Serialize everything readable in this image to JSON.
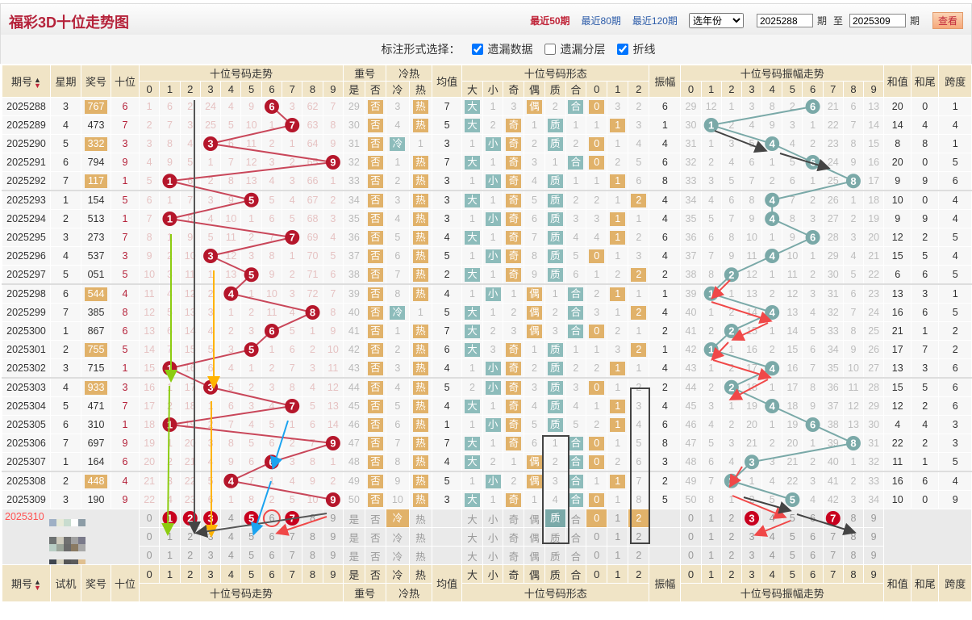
{
  "title": "福彩3D十位走势图",
  "nav": {
    "recent50": "最近50期",
    "recent80": "最近80期",
    "recent120": "最近120期",
    "year_select": "选年份",
    "from": "2025288",
    "period1": "期",
    "to_label": "至",
    "to": "2025309",
    "period2": "期",
    "view": "查看"
  },
  "options": {
    "label": "标注形式选择：",
    "opt1": "遗漏数据",
    "opt1_checked": true,
    "opt2": "遗漏分层",
    "opt2_checked": false,
    "opt3": "折线",
    "opt3_checked": true
  },
  "headers": {
    "issue": "期号",
    "week": "星期",
    "trial": "试机",
    "prize": "奖号",
    "tens": "十位",
    "trend": "十位号码走势",
    "repeat": "重号",
    "yes": "是",
    "no": "否",
    "hc": "冷热",
    "cold": "冷",
    "hot": "热",
    "avg": "均值",
    "shape": "十位号码形态",
    "shapes": [
      "大",
      "小",
      "奇",
      "偶",
      "质",
      "合"
    ],
    "mod3": [
      "0",
      "1",
      "2"
    ],
    "amp": "振幅",
    "amp_trend": "十位号码振幅走势",
    "sum": "和值",
    "tail": "和尾",
    "span": "跨度",
    "digits": [
      "0",
      "1",
      "2",
      "3",
      "4",
      "5",
      "6",
      "7",
      "8",
      "9"
    ]
  },
  "rows": [
    {
      "issue": "2025288",
      "week": "3",
      "prize": "767",
      "tens": "6",
      "trend": [
        1,
        6,
        2,
        24,
        4,
        9,
        6,
        3,
        62,
        7
      ],
      "mid": [
        "29",
        "否",
        "3",
        "热",
        "7",
        "大",
        "1",
        "3",
        "偶",
        "2",
        "合",
        "0",
        "3",
        "2",
        "6"
      ],
      "amp": [
        29,
        12,
        1,
        3,
        8,
        2,
        6,
        21,
        6,
        13
      ],
      "sum": "20",
      "tail": "0",
      "span": "1"
    },
    {
      "issue": "2025289",
      "week": "4",
      "prize": "473",
      "tens": "7",
      "trend": [
        2,
        7,
        3,
        25,
        5,
        10,
        1,
        7,
        63,
        8
      ],
      "mid": [
        "30",
        "否",
        "4",
        "热",
        "5",
        "大",
        "2",
        "奇",
        "1",
        "质",
        "1",
        "1",
        "1",
        "3",
        "1"
      ],
      "amp": [
        30,
        1,
        2,
        4,
        9,
        3,
        1,
        22,
        7,
        14
      ],
      "sum": "14",
      "tail": "4",
      "span": "4"
    },
    {
      "issue": "2025290",
      "week": "5",
      "prize": "332",
      "tens": "3",
      "trend": [
        3,
        8,
        4,
        3,
        6,
        11,
        2,
        1,
        64,
        9
      ],
      "mid": [
        "31",
        "否",
        "冷",
        "1",
        "3",
        "1",
        "小",
        "奇",
        "2",
        "质",
        "2",
        "0",
        "1",
        "4",
        "4"
      ],
      "amp": [
        31,
        1,
        3,
        5,
        4,
        4,
        2,
        23,
        8,
        15
      ],
      "sum": "8",
      "tail": "8",
      "span": "1"
    },
    {
      "issue": "2025291",
      "week": "6",
      "prize": "794",
      "tens": "9",
      "trend": [
        4,
        9,
        5,
        1,
        7,
        12,
        3,
        2,
        65,
        9
      ],
      "mid": [
        "32",
        "否",
        "1",
        "热",
        "7",
        "大",
        "1",
        "奇",
        "3",
        "1",
        "合",
        "0",
        "2",
        "5",
        "6"
      ],
      "amp": [
        32,
        2,
        4,
        6,
        1,
        5,
        6,
        24,
        9,
        16
      ],
      "sum": "20",
      "tail": "0",
      "span": "5"
    },
    {
      "issue": "2025292",
      "week": "7",
      "prize": "117",
      "tens": "1",
      "trend": [
        5,
        1,
        6,
        2,
        8,
        13,
        4,
        3,
        66,
        1
      ],
      "mid": [
        "33",
        "否",
        "2",
        "热",
        "3",
        "1",
        "小",
        "奇",
        "4",
        "质",
        "1",
        "1",
        "1",
        "6",
        "8"
      ],
      "amp": [
        33,
        3,
        5,
        7,
        2,
        6,
        1,
        25,
        8,
        17
      ],
      "sum": "9",
      "tail": "9",
      "span": "6"
    },
    {
      "issue": "2025293",
      "week": "1",
      "prize": "154",
      "tens": "5",
      "trend": [
        6,
        1,
        7,
        3,
        9,
        5,
        5,
        4,
        67,
        2
      ],
      "mid": [
        "34",
        "否",
        "3",
        "热",
        "3",
        "大",
        "1",
        "奇",
        "5",
        "质",
        "2",
        "2",
        "1",
        "2",
        "4"
      ],
      "amp": [
        34,
        4,
        6,
        8,
        4,
        7,
        2,
        26,
        1,
        18
      ],
      "sum": "10",
      "tail": "0",
      "span": "4"
    },
    {
      "issue": "2025294",
      "week": "2",
      "prize": "513",
      "tens": "1",
      "trend": [
        7,
        1,
        8,
        4,
        10,
        1,
        6,
        5,
        68,
        3
      ],
      "mid": [
        "35",
        "否",
        "4",
        "热",
        "3",
        "1",
        "小",
        "奇",
        "6",
        "质",
        "3",
        "3",
        "1",
        "1",
        "4"
      ],
      "amp": [
        35,
        5,
        7,
        9,
        4,
        8,
        3,
        27,
        2,
        19
      ],
      "sum": "9",
      "tail": "9",
      "span": "4"
    },
    {
      "issue": "2025295",
      "week": "3",
      "prize": "273",
      "tens": "7",
      "trend": [
        8,
        1,
        9,
        5,
        11,
        2,
        7,
        7,
        69,
        4
      ],
      "mid": [
        "36",
        "否",
        "5",
        "热",
        "4",
        "大",
        "1",
        "奇",
        "7",
        "质",
        "4",
        "4",
        "1",
        "2",
        "6"
      ],
      "amp": [
        36,
        6,
        8,
        10,
        1,
        9,
        6,
        28,
        3,
        20
      ],
      "sum": "12",
      "tail": "2",
      "span": "5"
    },
    {
      "issue": "2025296",
      "week": "4",
      "prize": "537",
      "tens": "3",
      "trend": [
        9,
        2,
        10,
        3,
        12,
        3,
        8,
        1,
        70,
        5
      ],
      "mid": [
        "37",
        "否",
        "6",
        "热",
        "5",
        "1",
        "小",
        "奇",
        "8",
        "质",
        "5",
        "0",
        "1",
        "3",
        "4"
      ],
      "amp": [
        37,
        7,
        9,
        11,
        4,
        10,
        1,
        29,
        4,
        21
      ],
      "sum": "15",
      "tail": "5",
      "span": "4"
    },
    {
      "issue": "2025297",
      "week": "5",
      "prize": "051",
      "tens": "5",
      "trend": [
        10,
        3,
        11,
        1,
        13,
        5,
        9,
        2,
        71,
        6
      ],
      "mid": [
        "38",
        "否",
        "7",
        "热",
        "2",
        "大",
        "1",
        "奇",
        "9",
        "质",
        "6",
        "1",
        "2",
        "2",
        "2"
      ],
      "amp": [
        38,
        8,
        2,
        12,
        1,
        11,
        2,
        30,
        5,
        22
      ],
      "sum": "6",
      "tail": "6",
      "span": "5"
    },
    {
      "issue": "2025298",
      "week": "6",
      "prize": "544",
      "tens": "4",
      "trend": [
        11,
        4,
        12,
        2,
        4,
        1,
        10,
        3,
        72,
        7
      ],
      "mid": [
        "39",
        "否",
        "8",
        "热",
        "4",
        "1",
        "小",
        "1",
        "偶",
        "1",
        "合",
        "2",
        "1",
        "1",
        "1"
      ],
      "amp": [
        39,
        1,
        1,
        13,
        2,
        12,
        3,
        31,
        6,
        23
      ],
      "sum": "13",
      "tail": "3",
      "span": "1"
    },
    {
      "issue": "2025299",
      "week": "7",
      "prize": "385",
      "tens": "8",
      "trend": [
        12,
        5,
        13,
        3,
        1,
        2,
        11,
        4,
        8,
        8
      ],
      "mid": [
        "40",
        "否",
        "冷",
        "1",
        "5",
        "大",
        "1",
        "2",
        "偶",
        "2",
        "合",
        "3",
        "1",
        "2",
        "4"
      ],
      "amp": [
        40,
        1,
        2,
        14,
        4,
        13,
        4,
        32,
        7,
        24
      ],
      "sum": "16",
      "tail": "6",
      "span": "5"
    },
    {
      "issue": "2025300",
      "week": "1",
      "prize": "867",
      "tens": "6",
      "trend": [
        13,
        6,
        14,
        4,
        2,
        3,
        6,
        5,
        1,
        9
      ],
      "mid": [
        "41",
        "否",
        "1",
        "热",
        "7",
        "大",
        "2",
        "3",
        "偶",
        "3",
        "合",
        "0",
        "2",
        "1",
        "2"
      ],
      "amp": [
        41,
        2,
        2,
        15,
        1,
        14,
        5,
        33,
        8,
        25
      ],
      "sum": "21",
      "tail": "1",
      "span": "2"
    },
    {
      "issue": "2025301",
      "week": "2",
      "prize": "755",
      "tens": "5",
      "trend": [
        14,
        7,
        15,
        5,
        3,
        5,
        1,
        6,
        2,
        10
      ],
      "mid": [
        "42",
        "否",
        "2",
        "热",
        "6",
        "大",
        "3",
        "奇",
        "1",
        "质",
        "1",
        "1",
        "3",
        "2",
        "1"
      ],
      "amp": [
        42,
        1,
        1,
        16,
        2,
        15,
        6,
        34,
        9,
        26
      ],
      "sum": "17",
      "tail": "7",
      "span": "2"
    },
    {
      "issue": "2025302",
      "week": "3",
      "prize": "715",
      "tens": "1",
      "trend": [
        15,
        1,
        16,
        6,
        4,
        1,
        2,
        7,
        3,
        11
      ],
      "mid": [
        "43",
        "否",
        "3",
        "热",
        "4",
        "1",
        "小",
        "奇",
        "2",
        "质",
        "2",
        "2",
        "1",
        "1",
        "4"
      ],
      "amp": [
        43,
        1,
        2,
        17,
        4,
        16,
        7,
        35,
        10,
        27
      ],
      "sum": "13",
      "tail": "3",
      "span": "6"
    },
    {
      "issue": "2025303",
      "week": "4",
      "prize": "933",
      "tens": "3",
      "trend": [
        16,
        1,
        17,
        3,
        5,
        2,
        3,
        8,
        4,
        12
      ],
      "mid": [
        "44",
        "否",
        "4",
        "热",
        "5",
        "2",
        "小",
        "奇",
        "3",
        "质",
        "3",
        "0",
        "1",
        "2",
        "2"
      ],
      "amp": [
        44,
        2,
        2,
        18,
        1,
        17,
        8,
        36,
        11,
        28
      ],
      "sum": "15",
      "tail": "5",
      "span": "6"
    },
    {
      "issue": "2025304",
      "week": "5",
      "prize": "471",
      "tens": "7",
      "trend": [
        17,
        2,
        18,
        1,
        6,
        3,
        4,
        7,
        5,
        13
      ],
      "mid": [
        "45",
        "否",
        "5",
        "热",
        "4",
        "大",
        "1",
        "奇",
        "4",
        "质",
        "4",
        "1",
        "1",
        "3",
        "4"
      ],
      "amp": [
        45,
        3,
        1,
        19,
        4,
        18,
        9,
        37,
        12,
        29
      ],
      "sum": "12",
      "tail": "2",
      "span": "6"
    },
    {
      "issue": "2025305",
      "week": "6",
      "prize": "310",
      "tens": "1",
      "trend": [
        18,
        1,
        19,
        2,
        7,
        4,
        5,
        1,
        6,
        14
      ],
      "mid": [
        "46",
        "否",
        "6",
        "热",
        "1",
        "1",
        "小",
        "奇",
        "5",
        "质",
        "5",
        "2",
        "1",
        "4",
        "6"
      ],
      "amp": [
        46,
        4,
        2,
        20,
        1,
        19,
        6,
        38,
        13,
        30
      ],
      "sum": "4",
      "tail": "4",
      "span": "3"
    },
    {
      "issue": "2025306",
      "week": "7",
      "prize": "697",
      "tens": "9",
      "trend": [
        19,
        1,
        20,
        3,
        8,
        5,
        6,
        2,
        7,
        9
      ],
      "mid": [
        "47",
        "否",
        "7",
        "热",
        "7",
        "大",
        "1",
        "奇",
        "6",
        "1",
        "合",
        "0",
        "1",
        "5",
        "8"
      ],
      "amp": [
        47,
        5,
        3,
        21,
        2,
        20,
        1,
        39,
        8,
        31
      ],
      "sum": "22",
      "tail": "2",
      "span": "3"
    },
    {
      "issue": "2025307",
      "week": "1",
      "prize": "164",
      "tens": "6",
      "trend": [
        20,
        2,
        21,
        4,
        9,
        6,
        6,
        3,
        8,
        1
      ],
      "mid": [
        "48",
        "否",
        "8",
        "热",
        "4",
        "大",
        "2",
        "1",
        "偶",
        "2",
        "合",
        "0",
        "2",
        "6",
        "3"
      ],
      "amp": [
        48,
        6,
        4,
        3,
        3,
        21,
        2,
        40,
        1,
        32
      ],
      "sum": "11",
      "tail": "1",
      "span": "5"
    },
    {
      "issue": "2025308",
      "week": "2",
      "prize": "448",
      "tens": "4",
      "trend": [
        21,
        3,
        22,
        5,
        4,
        7,
        1,
        4,
        9,
        2
      ],
      "mid": [
        "49",
        "否",
        "9",
        "热",
        "5",
        "1",
        "小",
        "2",
        "偶",
        "3",
        "合",
        "1",
        "1",
        "7",
        "2"
      ],
      "amp": [
        49,
        7,
        2,
        1,
        4,
        22,
        3,
        41,
        2,
        33
      ],
      "sum": "16",
      "tail": "6",
      "span": "4"
    },
    {
      "issue": "2025309",
      "week": "3",
      "prize": "190",
      "tens": "9",
      "trend": [
        22,
        4,
        23,
        6,
        1,
        8,
        2,
        5,
        10,
        9
      ],
      "mid": [
        "50",
        "否",
        "10",
        "热",
        "3",
        "大",
        "1",
        "奇",
        "1",
        "4",
        "合",
        "0",
        "1",
        "8",
        "5"
      ],
      "amp": [
        50,
        8,
        1,
        2,
        5,
        5,
        4,
        42,
        3,
        34
      ],
      "sum": "10",
      "tail": "0",
      "span": "9"
    }
  ],
  "forecast": {
    "issue": "2025310",
    "trend_marked": [
      1,
      2,
      3,
      5,
      7
    ],
    "trend_circled": 6,
    "hc_pick": "冷",
    "shape_pick": "质",
    "mod3_picks": [
      0,
      2
    ],
    "amp_marked": [
      3,
      7
    ]
  },
  "colors": {
    "title": "#b5223a",
    "header_bg": "#f0e4c6",
    "orange": "#e1b26a",
    "teal": "#8dbcbb",
    "trend_ball": "#b5162b",
    "amp_ball": "#7aa9a8"
  }
}
